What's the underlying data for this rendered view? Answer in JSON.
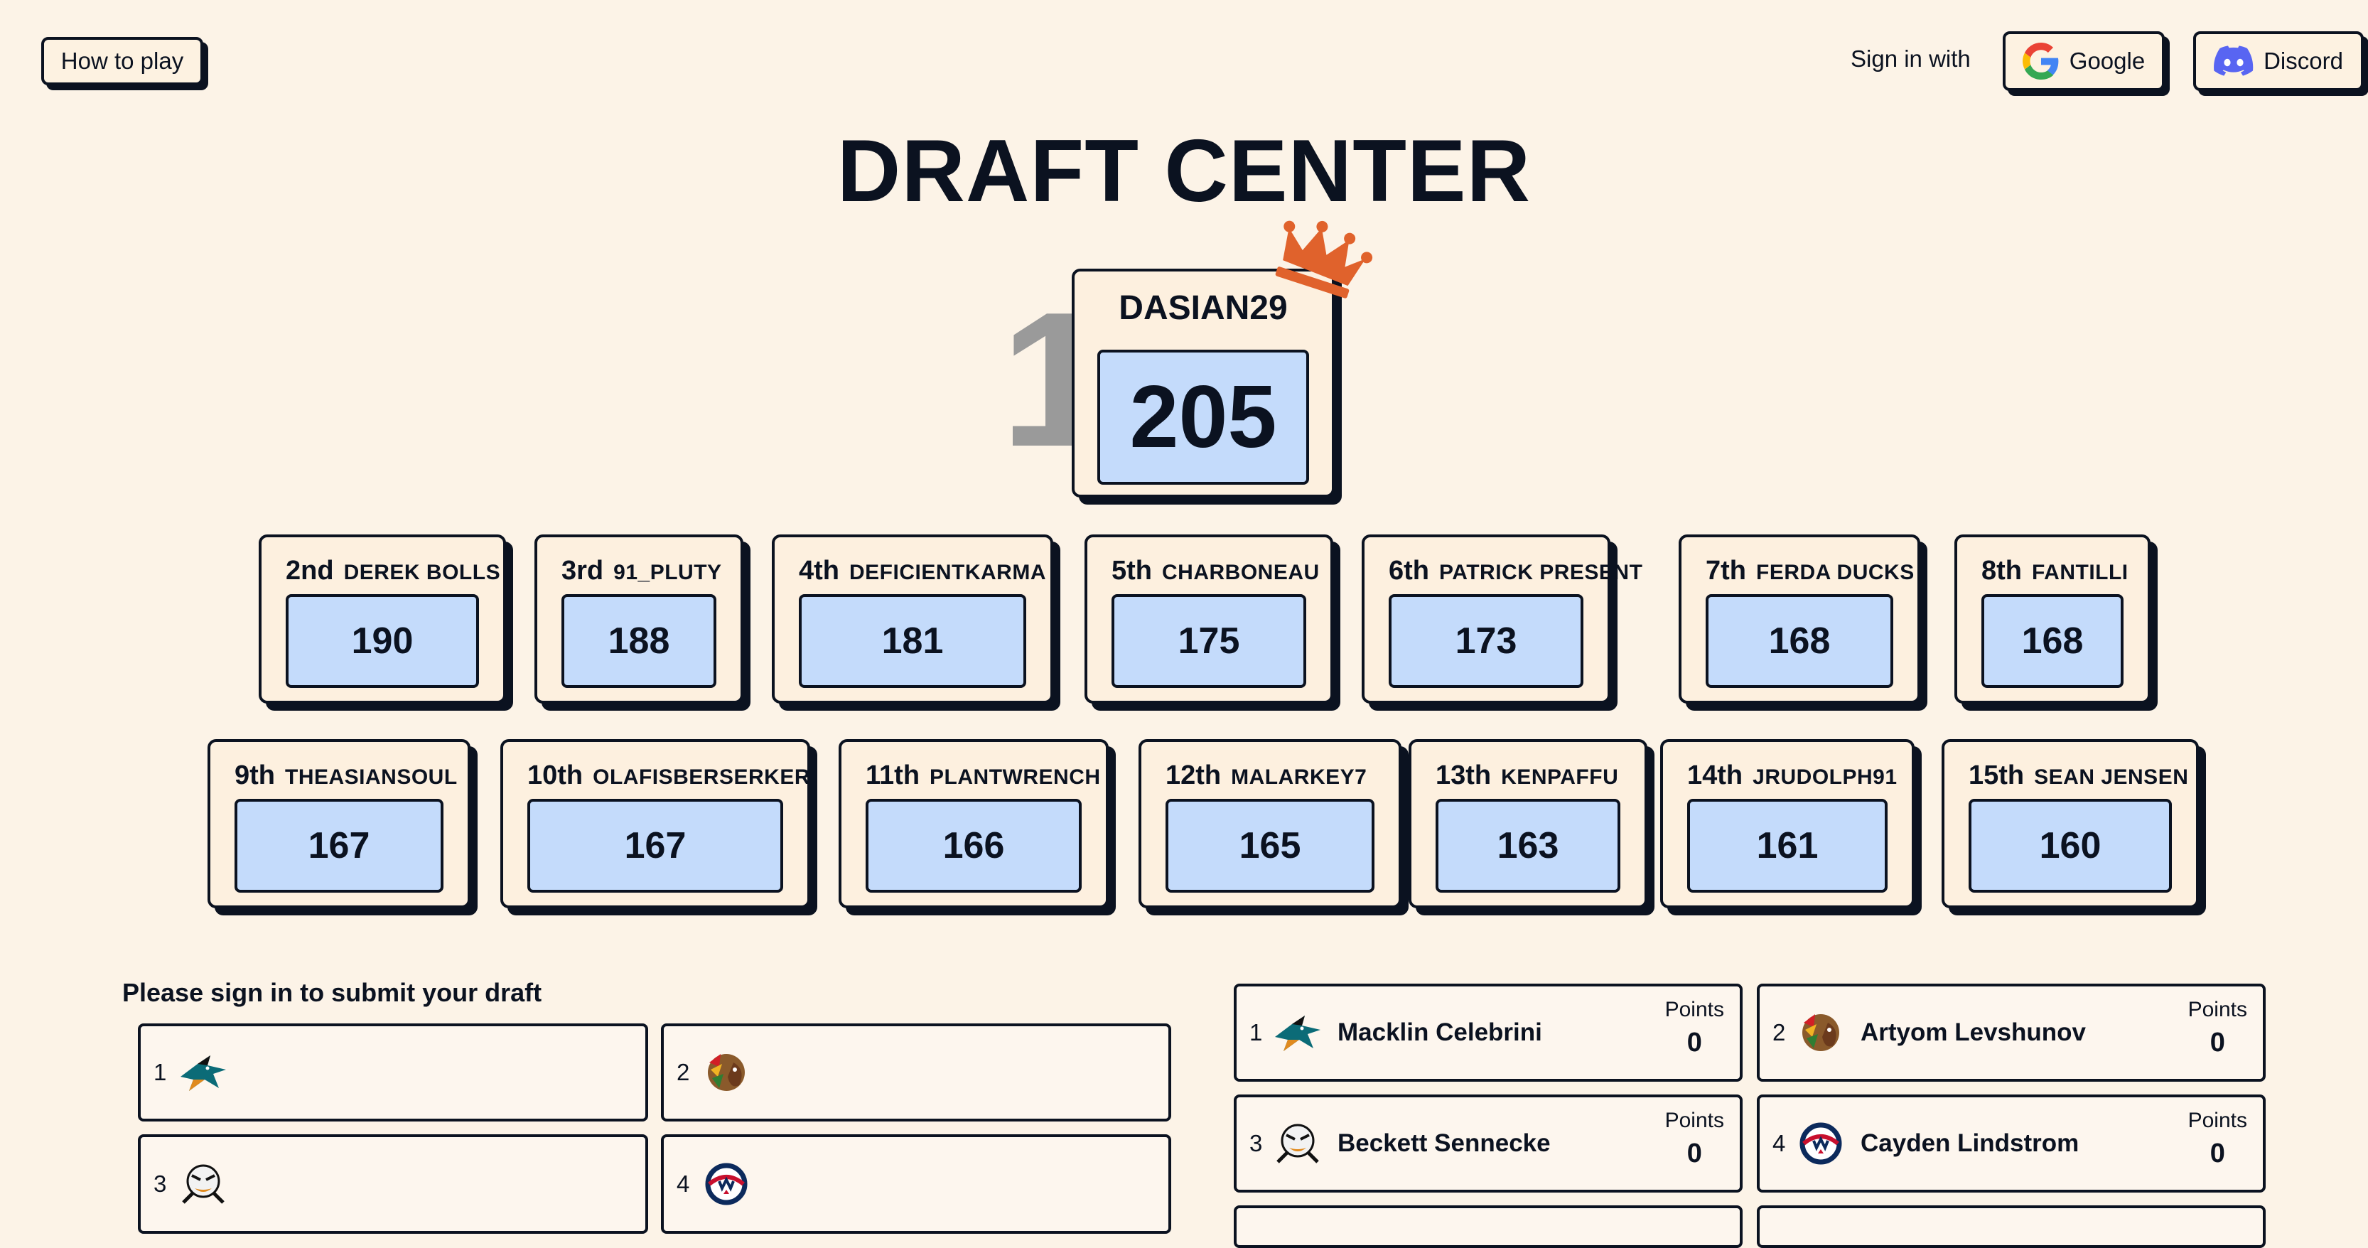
{
  "header": {
    "how_to_play": "How to play",
    "sign_in_with": "Sign in with",
    "google": "Google",
    "discord": "Discord"
  },
  "title": "DRAFT CENTER",
  "winner": {
    "rank": "1",
    "name": "DASIAN29",
    "score": "205"
  },
  "leaderboard": [
    {
      "rank": "2nd",
      "name": "DEREK BOLLS",
      "score": "190"
    },
    {
      "rank": "3rd",
      "name": "91_PLUTY",
      "score": "188"
    },
    {
      "rank": "4th",
      "name": "DEFICIENTKARMA",
      "score": "181"
    },
    {
      "rank": "5th",
      "name": "CHARBONEAU",
      "score": "175"
    },
    {
      "rank": "6th",
      "name": "PATRICK PRESENT",
      "score": "173"
    },
    {
      "rank": "7th",
      "name": "FERDA DUCKS",
      "score": "168"
    },
    {
      "rank": "8th",
      "name": "FANTILLI",
      "score": "168"
    },
    {
      "rank": "9th",
      "name": "THEASIANSOUL",
      "score": "167"
    },
    {
      "rank": "10th",
      "name": "OLAFISBERSERKER",
      "score": "167"
    },
    {
      "rank": "11th",
      "name": "PLANTWRENCH",
      "score": "166"
    },
    {
      "rank": "12th",
      "name": "MALARKEY7",
      "score": "165"
    },
    {
      "rank": "13th",
      "name": "KENPAFFU",
      "score": "163"
    },
    {
      "rank": "14th",
      "name": "JRUDOLPH91",
      "score": "161"
    },
    {
      "rank": "15th",
      "name": "SEAN JENSEN",
      "score": "160"
    }
  ],
  "draft": {
    "prompt": "Please sign in to submit your draft",
    "slots": [
      {
        "num": "1",
        "team_icon": "sharks-logo"
      },
      {
        "num": "2",
        "team_icon": "blackhawks-logo"
      },
      {
        "num": "3",
        "team_icon": "ducks-logo"
      },
      {
        "num": "4",
        "team_icon": "blue-jackets-logo"
      }
    ]
  },
  "picks": [
    {
      "num": "1",
      "name": "Macklin Celebrini",
      "points_label": "Points",
      "points": "0",
      "team_icon": "sharks-logo"
    },
    {
      "num": "2",
      "name": "Artyom Levshunov",
      "points_label": "Points",
      "points": "0",
      "team_icon": "blackhawks-logo"
    },
    {
      "num": "3",
      "name": "Beckett Sennecke",
      "points_label": "Points",
      "points": "0",
      "team_icon": "ducks-logo"
    },
    {
      "num": "4",
      "name": "Cayden Lindstrom",
      "points_label": "Points",
      "points": "0",
      "team_icon": "blue-jackets-logo"
    }
  ],
  "colors": {
    "background": "#fcf3e7",
    "card": "#fdf0df",
    "score": "#c4dbfb",
    "crown": "#e0622c",
    "ink": "#0b1220"
  }
}
